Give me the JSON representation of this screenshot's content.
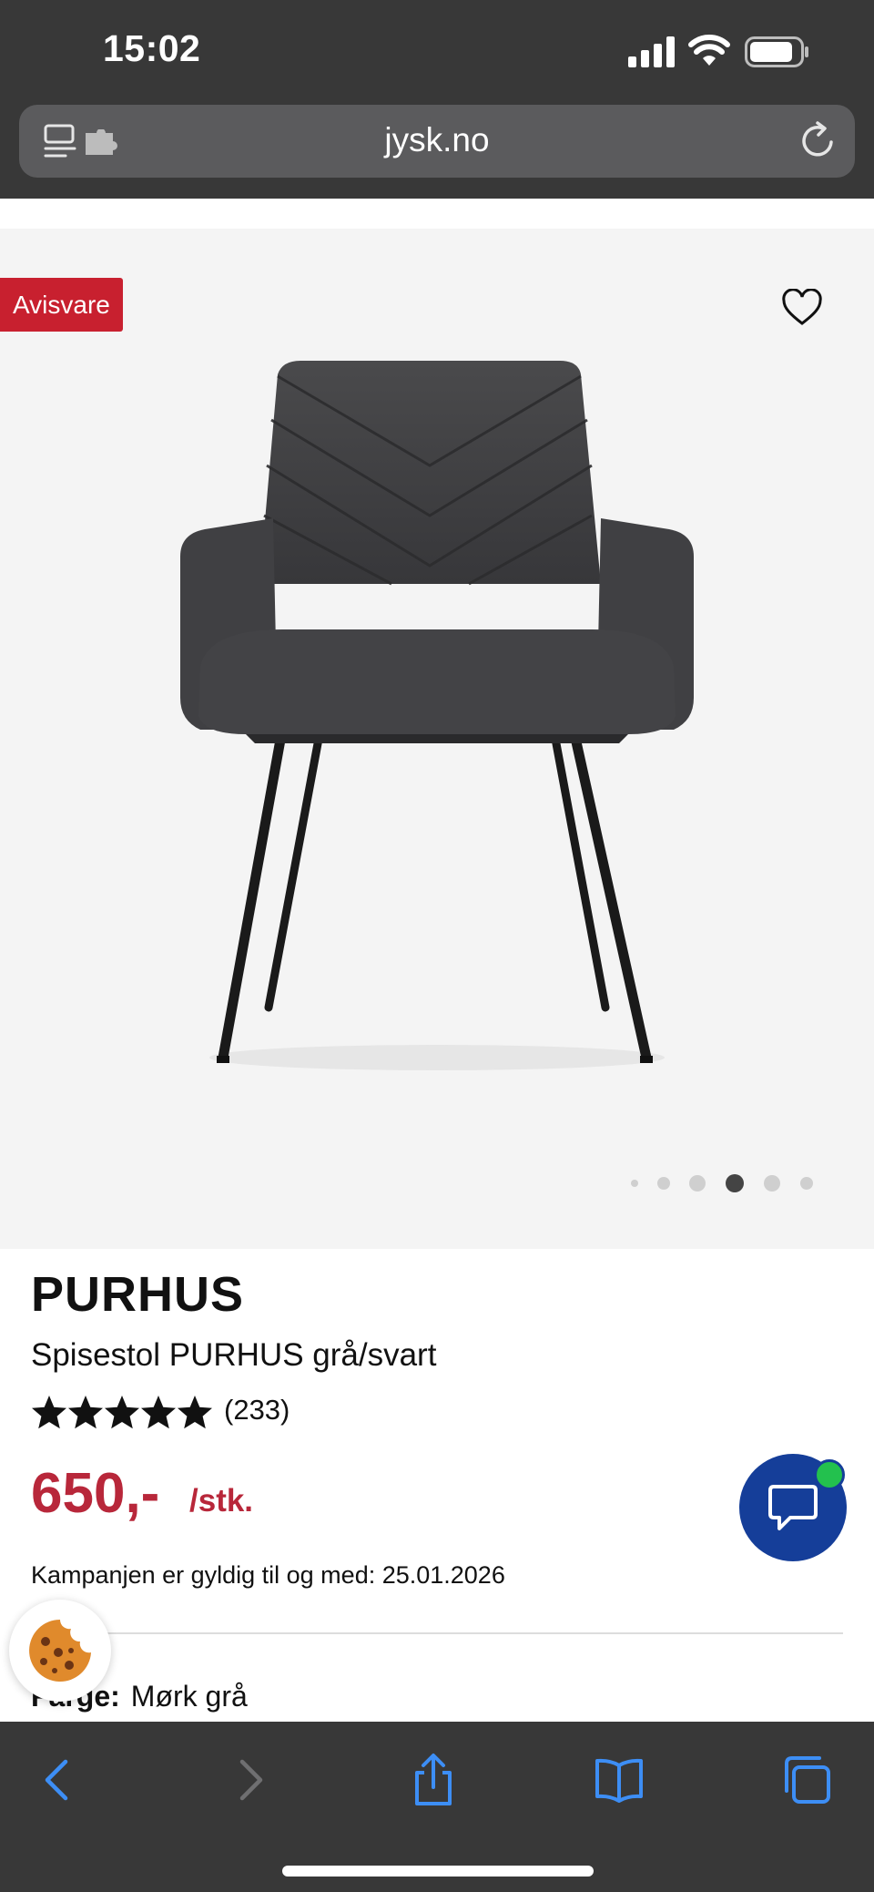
{
  "status_bar": {
    "time": "15:02",
    "icons": [
      "signal-icon",
      "wifi-icon",
      "battery-icon"
    ]
  },
  "address_bar": {
    "url": "jysk.no",
    "icons": [
      "reader-icon",
      "extension-icon",
      "reload-icon"
    ]
  },
  "product": {
    "badge": "Avisvare",
    "brand": "PURHUS",
    "name": "Spisestol PURHUS grå/svart",
    "rating": 5,
    "review_count": "(233)",
    "price": "650,-",
    "unit": "/stk.",
    "campaign_text": "Kampanjen er gyldig til og med: 25.01.2026",
    "color_label": "Farge:",
    "color_value": "Mørk grå"
  },
  "gallery": {
    "image_count": 6,
    "active_index": 3
  },
  "colors": {
    "chrome": "#383838",
    "price": "#b8273a",
    "badge": "#c8202f",
    "chat": "#153e99",
    "online": "#23c14e",
    "toolbar_icon": "#3d8ef5"
  },
  "toolbar": {
    "icons": [
      "back-icon",
      "forward-icon",
      "share-icon",
      "bookmarks-icon",
      "tabs-icon"
    ]
  }
}
